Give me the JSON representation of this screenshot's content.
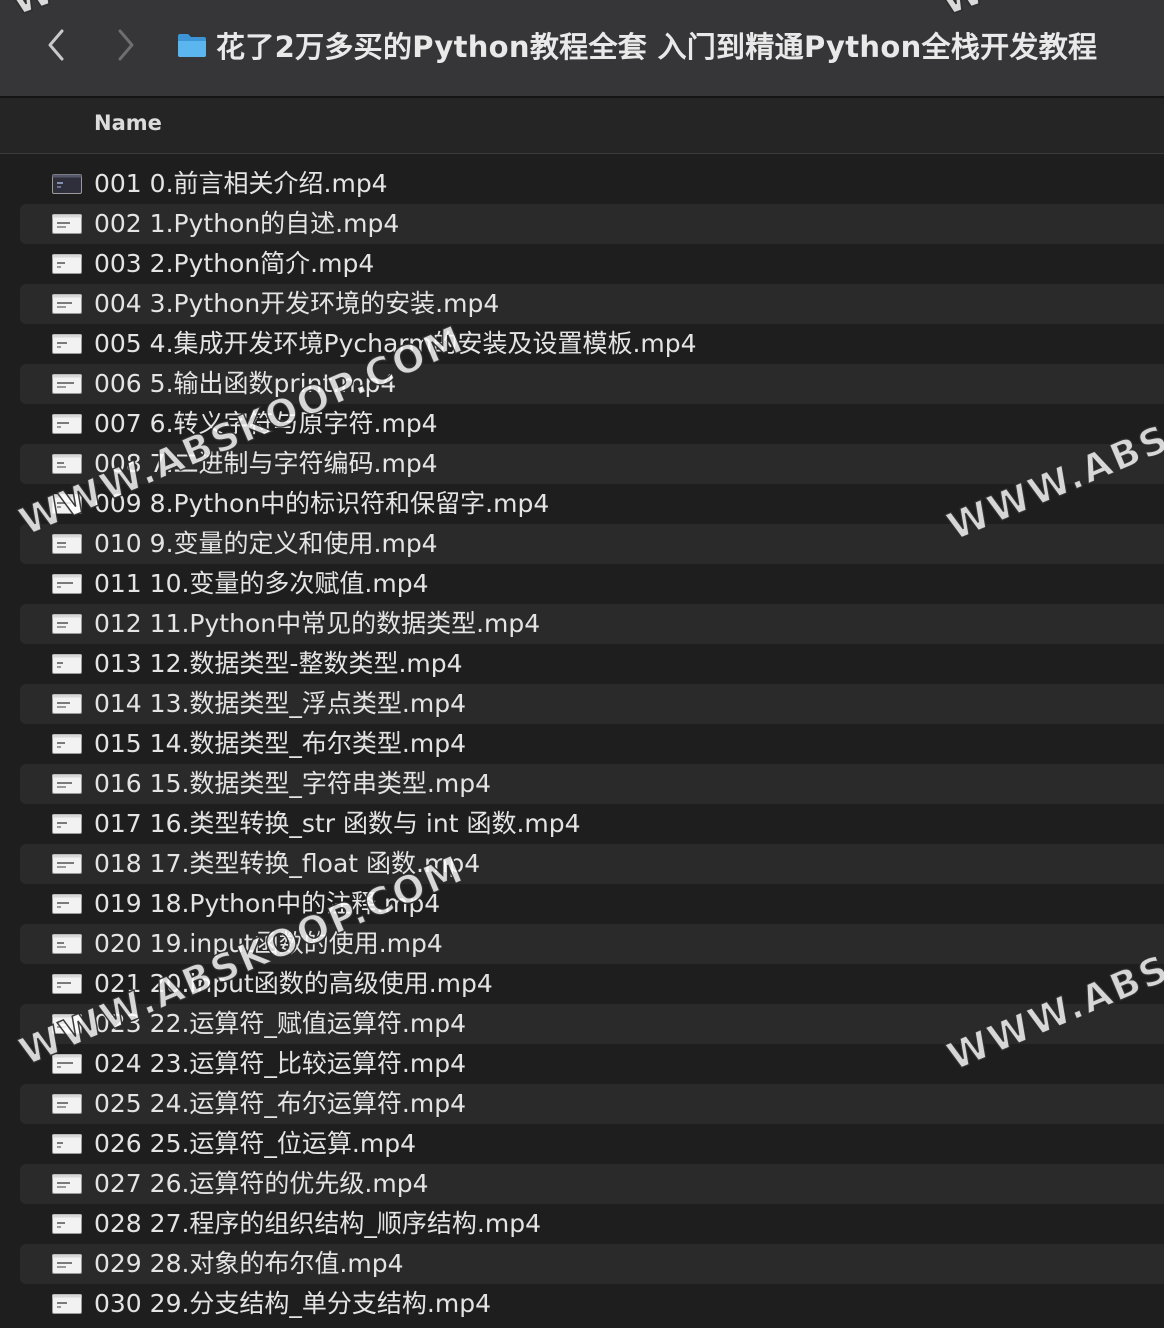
{
  "window": {
    "title": "花了2万多买的Python教程全套 入门到精通Python全栈开发教程",
    "back_icon": "chevron-left-icon",
    "forward_icon": "chevron-right-icon",
    "folder_icon": "folder-icon",
    "folder_color": "#4aa9e8"
  },
  "header": {
    "name_column": "Name"
  },
  "files": [
    {
      "name": "001 0.前言相关介绍.mp4",
      "icon": "video-thumbnail-icon"
    },
    {
      "name": "002 1.Python的自述.mp4",
      "icon": "video-thumbnail-icon"
    },
    {
      "name": "003 2.Python简介.mp4",
      "icon": "video-thumbnail-icon"
    },
    {
      "name": "004 3.Python开发环境的安装.mp4",
      "icon": "video-thumbnail-icon"
    },
    {
      "name": "005 4.集成开发环境Pycharm的安装及设置模板.mp4",
      "icon": "video-thumbnail-icon"
    },
    {
      "name": "006 5.输出函数print.mp4",
      "icon": "video-thumbnail-icon"
    },
    {
      "name": "007 6.转义字符与原字符.mp4",
      "icon": "video-thumbnail-icon"
    },
    {
      "name": "008 7.二进制与字符编码.mp4",
      "icon": "video-thumbnail-icon"
    },
    {
      "name": "009 8.Python中的标识符和保留字.mp4",
      "icon": "video-thumbnail-icon"
    },
    {
      "name": "010 9.变量的定义和使用.mp4",
      "icon": "video-thumbnail-icon"
    },
    {
      "name": "011 10.变量的多次赋值.mp4",
      "icon": "video-thumbnail-icon"
    },
    {
      "name": "012 11.Python中常见的数据类型.mp4",
      "icon": "video-thumbnail-icon"
    },
    {
      "name": "013 12.数据类型-整数类型.mp4",
      "icon": "video-thumbnail-icon"
    },
    {
      "name": "014 13.数据类型_浮点类型.mp4",
      "icon": "video-thumbnail-icon"
    },
    {
      "name": "015 14.数据类型_布尔类型.mp4",
      "icon": "video-thumbnail-icon"
    },
    {
      "name": "016 15.数据类型_字符串类型.mp4",
      "icon": "video-thumbnail-icon"
    },
    {
      "name": "017 16.类型转换_str  函数与 int  函数.mp4",
      "icon": "video-thumbnail-icon"
    },
    {
      "name": "018 17.类型转换_float  函数.mp4",
      "icon": "video-thumbnail-icon"
    },
    {
      "name": "019 18.Python中的注释.mp4",
      "icon": "video-thumbnail-icon"
    },
    {
      "name": "020 19.input函数的使用.mp4",
      "icon": "video-thumbnail-icon"
    },
    {
      "name": "021 20.input函数的高级使用.mp4",
      "icon": "video-thumbnail-icon"
    },
    {
      "name": "023 22.运算符_赋值运算符.mp4",
      "icon": "video-thumbnail-icon"
    },
    {
      "name": "024 23.运算符_比较运算符.mp4",
      "icon": "video-thumbnail-icon"
    },
    {
      "name": "025 24.运算符_布尔运算符.mp4",
      "icon": "video-thumbnail-icon"
    },
    {
      "name": "026 25.运算符_位运算.mp4",
      "icon": "video-thumbnail-icon"
    },
    {
      "name": "027 26.运算符的优先级.mp4",
      "icon": "video-thumbnail-icon"
    },
    {
      "name": "028 27.程序的组织结构_顺序结构.mp4",
      "icon": "video-thumbnail-icon"
    },
    {
      "name": "029 28.对象的布尔值.mp4",
      "icon": "video-thumbnail-icon"
    },
    {
      "name": "030 29.分支结构_单分支结构.mp4",
      "icon": "video-thumbnail-icon"
    }
  ],
  "watermarks": [
    {
      "text": "WWW.ABSKOOP.COM"
    },
    {
      "text": "WWW.ABSKOOP.COM"
    },
    {
      "text": "WWW.ABSI"
    },
    {
      "text": "WWW.ABSI"
    },
    {
      "text": "WW"
    },
    {
      "text": "WW"
    }
  ],
  "colors": {
    "titlebar_bg": "#363638",
    "list_bg": "#1e1e1e",
    "alt_row_bg": "#2a2a2b"
  }
}
